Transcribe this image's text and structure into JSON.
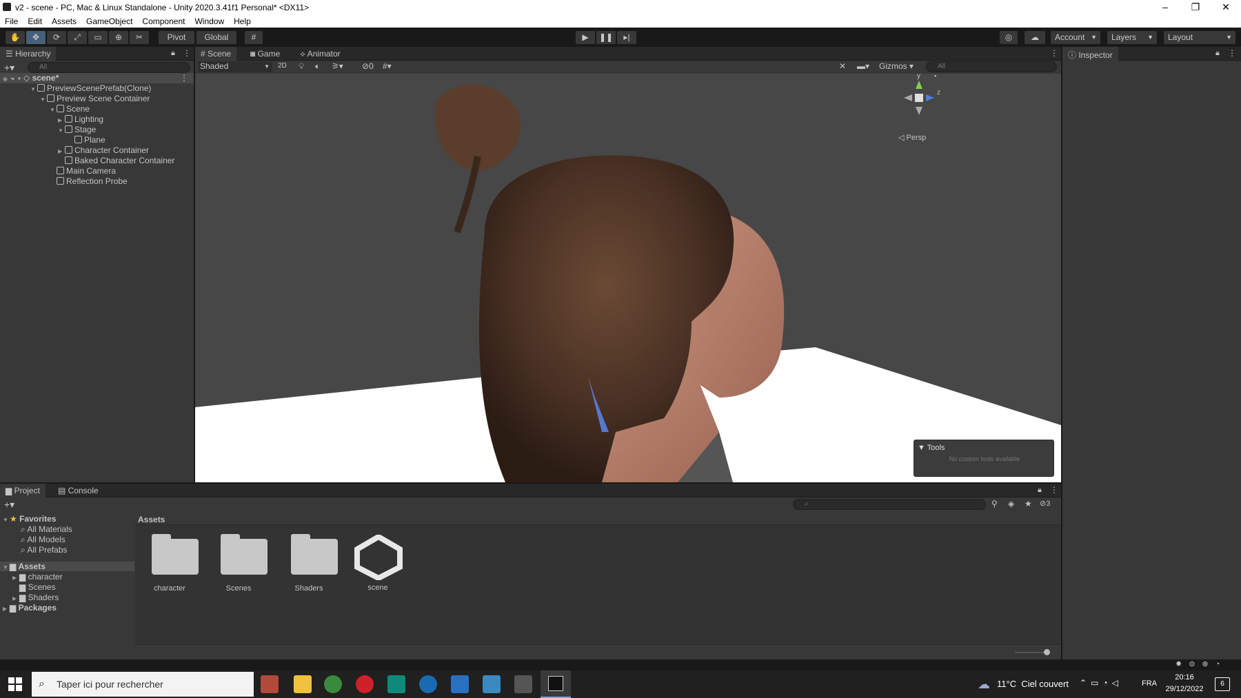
{
  "window": {
    "title": "v2 - scene - PC, Mac & Linux Standalone - Unity 2020.3.41f1 Personal* <DX11>",
    "minimize": "–",
    "restore": "❐",
    "close": "✕"
  },
  "menu": [
    "File",
    "Edit",
    "Assets",
    "GameObject",
    "Component",
    "Window",
    "Help"
  ],
  "toolbar": {
    "pivot": "Pivot",
    "global": "Global",
    "account": "Account",
    "layers": "Layers",
    "layout": "Layout"
  },
  "hierarchy": {
    "title": "Hierarchy",
    "search_placeholder": "All",
    "items": [
      {
        "label": "scene*"
      },
      {
        "label": "PreviewScenePrefab(Clone)"
      },
      {
        "label": "Preview Scene Container"
      },
      {
        "label": "Scene"
      },
      {
        "label": "Lighting"
      },
      {
        "label": "Stage"
      },
      {
        "label": "Plane"
      },
      {
        "label": "Character Container"
      },
      {
        "label": "Baked Character Container"
      },
      {
        "label": "Main Camera"
      },
      {
        "label": "Reflection Probe"
      }
    ]
  },
  "scene": {
    "tabs": [
      "Scene",
      "Game",
      "Animator"
    ],
    "shading": "Shaded",
    "mode2d": "2D",
    "hidden_count": "0",
    "gizmos": "Gizmos",
    "search_placeholder": "All",
    "axis_y": "y",
    "axis_z": "z",
    "projection": "Persp",
    "tools_title": "Tools",
    "tools_msg": "No custom tools available"
  },
  "inspector": {
    "title": "Inspector"
  },
  "project": {
    "tabs": [
      "Project",
      "Console"
    ],
    "hidden_count": "3",
    "favorites_label": "Favorites",
    "favorites": [
      "All Materials",
      "All Models",
      "All Prefabs"
    ],
    "assets_label": "Assets",
    "asset_folders": [
      "character",
      "Scenes",
      "Shaders"
    ],
    "packages_label": "Packages",
    "breadcrumb": "Assets",
    "grid": [
      {
        "label": "character",
        "kind": "folder"
      },
      {
        "label": "Scenes",
        "kind": "folder"
      },
      {
        "label": "Shaders",
        "kind": "folder"
      },
      {
        "label": "scene",
        "kind": "unity-scene"
      }
    ]
  },
  "taskbar": {
    "search_placeholder": "Taper ici pour rechercher",
    "weather": "11°C  Ciel couvert",
    "lang": "FRA",
    "time": "20:16",
    "date": "29/12/2022",
    "notifications": "6"
  },
  "colors": {
    "accent": "#46607c",
    "selected": "#2c5d87",
    "background": "#383838"
  }
}
